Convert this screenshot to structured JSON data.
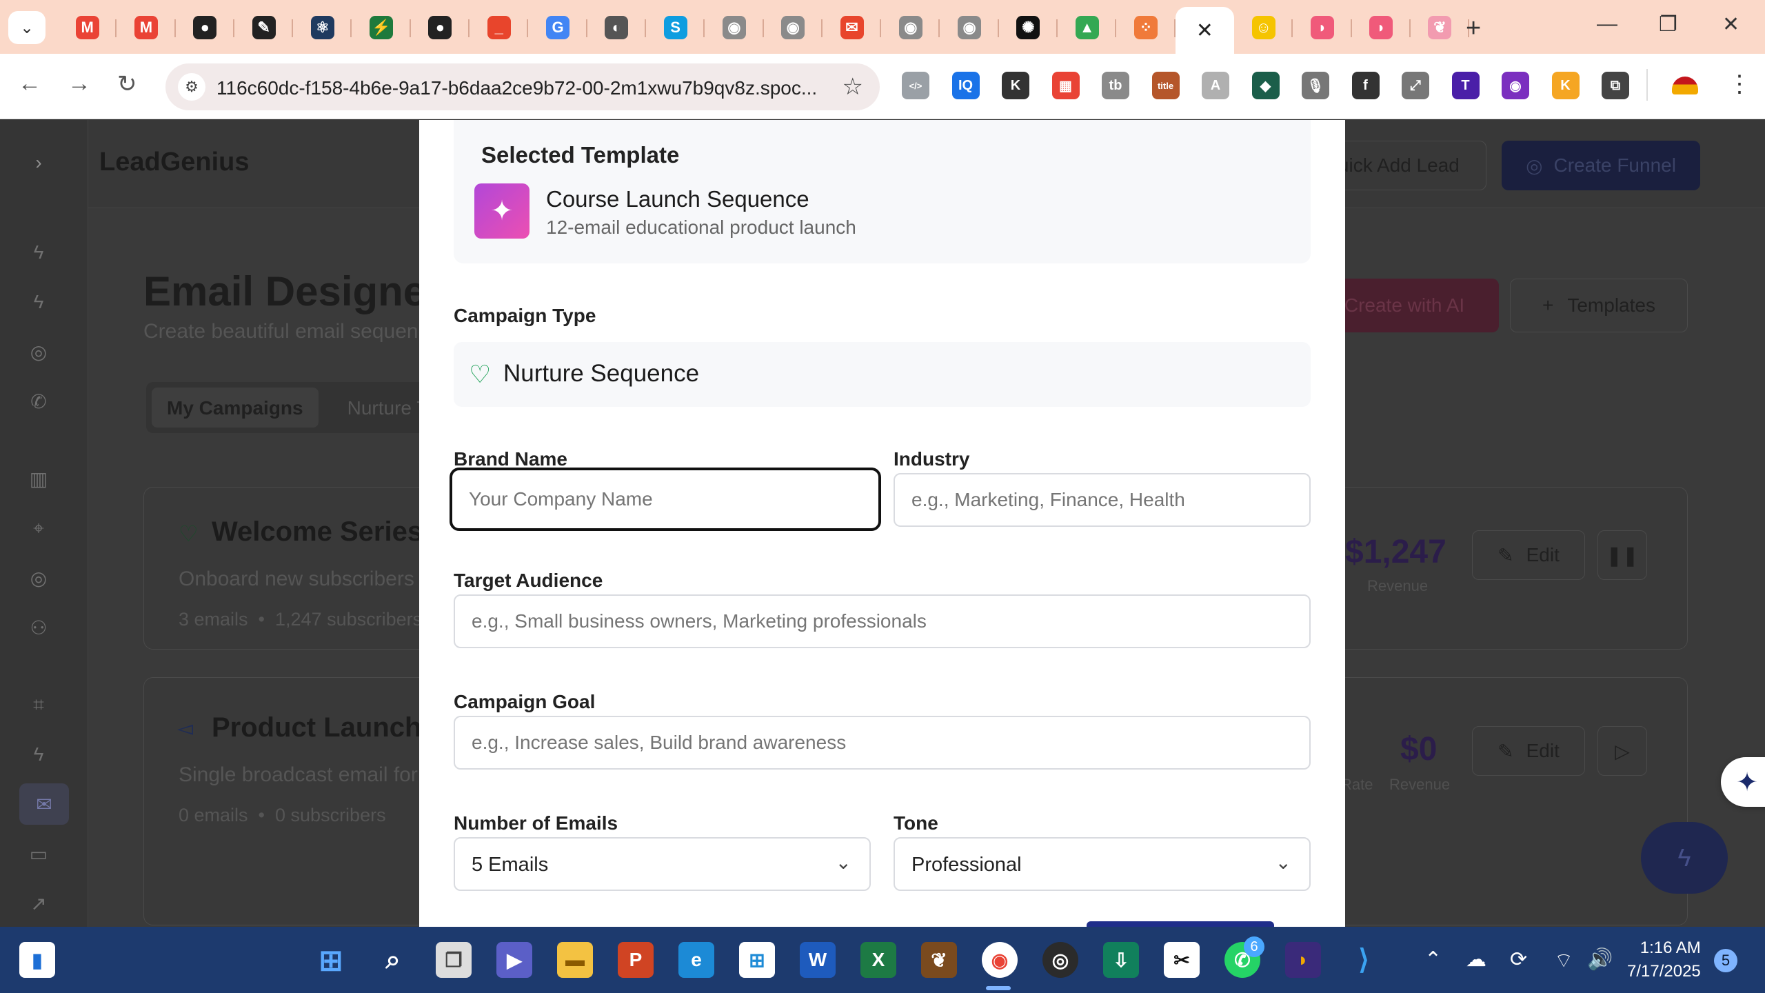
{
  "browser": {
    "tab_menu_icon": "chevron-down-icon",
    "tabs": [
      {
        "icon": "gmail-icon",
        "color": "#ea4335",
        "glyph": "M"
      },
      {
        "icon": "gmail-icon",
        "color": "#ea4335",
        "glyph": "M"
      },
      {
        "icon": "github-icon",
        "color": "#222222",
        "glyph": "●"
      },
      {
        "icon": "brush-icon",
        "color": "#222222",
        "glyph": "✎"
      },
      {
        "icon": "react-icon",
        "color": "#1f3a5f",
        "glyph": "⚛"
      },
      {
        "icon": "bolt-app-icon",
        "color": "#1e7a3c",
        "glyph": "⚡"
      },
      {
        "icon": "github-icon",
        "color": "#222222",
        "glyph": "●"
      },
      {
        "icon": "notes-icon",
        "color": "#e8452c",
        "glyph": "_"
      },
      {
        "icon": "google-icon",
        "color": "#4285f4",
        "glyph": "G"
      },
      {
        "icon": "globe-icon",
        "color": "#555555",
        "glyph": "◐"
      },
      {
        "icon": "skype-icon",
        "color": "#0e9de0",
        "glyph": "S"
      },
      {
        "icon": "profile-icon",
        "color": "#8a8a8a",
        "glyph": "◉"
      },
      {
        "icon": "profile-icon",
        "color": "#8a8a8a",
        "glyph": "◉"
      },
      {
        "icon": "mail-chart-icon",
        "color": "#e8452c",
        "glyph": "✉"
      },
      {
        "icon": "profile-icon",
        "color": "#8a8a8a",
        "glyph": "◉"
      },
      {
        "icon": "profile-icon",
        "color": "#8a8a8a",
        "glyph": "◉"
      },
      {
        "icon": "openai-icon",
        "color": "#111111",
        "glyph": "✺"
      },
      {
        "icon": "google-drive-icon",
        "color": "#34a853",
        "glyph": "▲"
      },
      {
        "icon": "grid-app-icon",
        "color": "#f07a3a",
        "glyph": "⁘"
      },
      {
        "icon": "close-icon",
        "color": "#ffffff",
        "glyph": "✕",
        "active": true
      },
      {
        "icon": "mailchimp-icon",
        "color": "#f5c400",
        "glyph": "☺"
      },
      {
        "icon": "arc-icon",
        "color": "#f05a7a",
        "glyph": "◗"
      },
      {
        "icon": "arc-icon",
        "color": "#f05a7a",
        "glyph": "◗"
      },
      {
        "icon": "brain-icon",
        "color": "#f29bb0",
        "glyph": "❦"
      }
    ],
    "url": "116c60dc-f158-4b6e-9a17-b6daa2ce9b72-00-2m1xwu7b9qv8z.spoc...",
    "extensions": [
      {
        "icon": "code-ext-icon",
        "color": "#9aa0a6",
        "glyph": "</>"
      },
      {
        "icon": "iq-ext-icon",
        "color": "#1a73e8",
        "glyph": "IQ"
      },
      {
        "icon": "k-ext-icon",
        "color": "#333333",
        "glyph": "K"
      },
      {
        "icon": "palette-ext-icon",
        "color": "#e94335",
        "glyph": "▦"
      },
      {
        "icon": "tb-ext-icon",
        "color": "#8a8a8a",
        "glyph": "tb"
      },
      {
        "icon": "title-ext-icon",
        "color": "#b5562a",
        "glyph": "title"
      },
      {
        "icon": "translate-ext-icon",
        "color": "#b0b0b0",
        "glyph": "A"
      },
      {
        "icon": "diamond-ext-icon",
        "color": "#1b5e4a",
        "glyph": "◆"
      },
      {
        "icon": "mic-ext-icon",
        "color": "#777777",
        "glyph": "🎙"
      },
      {
        "icon": "function-ext-icon",
        "color": "#333333",
        "glyph": "f"
      },
      {
        "icon": "expand-ext-icon",
        "color": "#777777",
        "glyph": "⤢"
      },
      {
        "icon": "t-ext-icon",
        "color": "#4a1fa8",
        "glyph": "T"
      },
      {
        "icon": "eye-ext-icon",
        "color": "#7b2fbf",
        "glyph": "◉"
      },
      {
        "icon": "k-yellow-ext-icon",
        "color": "#f5a623",
        "glyph": "K"
      },
      {
        "icon": "puzzle-icon",
        "color": "#444444",
        "glyph": "⧉"
      }
    ]
  },
  "app": {
    "logo": "LeadGenius",
    "header_buttons": {
      "quick_add": "Quick Add Lead",
      "create_funnel": "Create Funnel"
    },
    "page_title": "Email Designer",
    "page_subtitle": "Create beautiful email sequences",
    "action_buttons": {
      "create_ai": "Create with AI",
      "templates": "Templates"
    },
    "tabs": [
      "My Campaigns",
      "Nurture Templates"
    ],
    "campaigns": [
      {
        "title": "Welcome Series",
        "desc": "Onboard new subscribers",
        "emails": "3 emails",
        "subs": "1,247 subscribers",
        "revenue": "$1,247",
        "revenue_label": "Revenue",
        "edit": "Edit"
      },
      {
        "title": "Product Launch Announcement",
        "desc": "Single broadcast email for product launch",
        "emails": "0 emails",
        "subs": "0 subscribers",
        "rate_label": "Rate",
        "revenue": "$0",
        "revenue_label": "Revenue",
        "edit": "Edit"
      }
    ]
  },
  "modal": {
    "selected_template_heading": "Selected Template",
    "template_name": "Course Launch Sequence",
    "template_desc": "12-email educational product launch",
    "campaign_type_label": "Campaign Type",
    "campaign_type_value": "Nurture Sequence",
    "brand_name_label": "Brand Name",
    "brand_name_placeholder": "Your Company Name",
    "industry_label": "Industry",
    "industry_placeholder": "e.g., Marketing, Finance, Health",
    "audience_label": "Target Audience",
    "audience_placeholder": "e.g., Small business owners, Marketing professionals",
    "goal_label": "Campaign Goal",
    "goal_placeholder": "e.g., Increase sales, Build brand awareness",
    "num_emails_label": "Number of Emails",
    "num_emails_value": "5 Emails",
    "tone_label": "Tone",
    "tone_value": "Professional"
  },
  "taskbar": {
    "time": "1:16 AM",
    "date": "7/17/2025",
    "whatsapp_badge": "6",
    "notification_count": "5"
  }
}
